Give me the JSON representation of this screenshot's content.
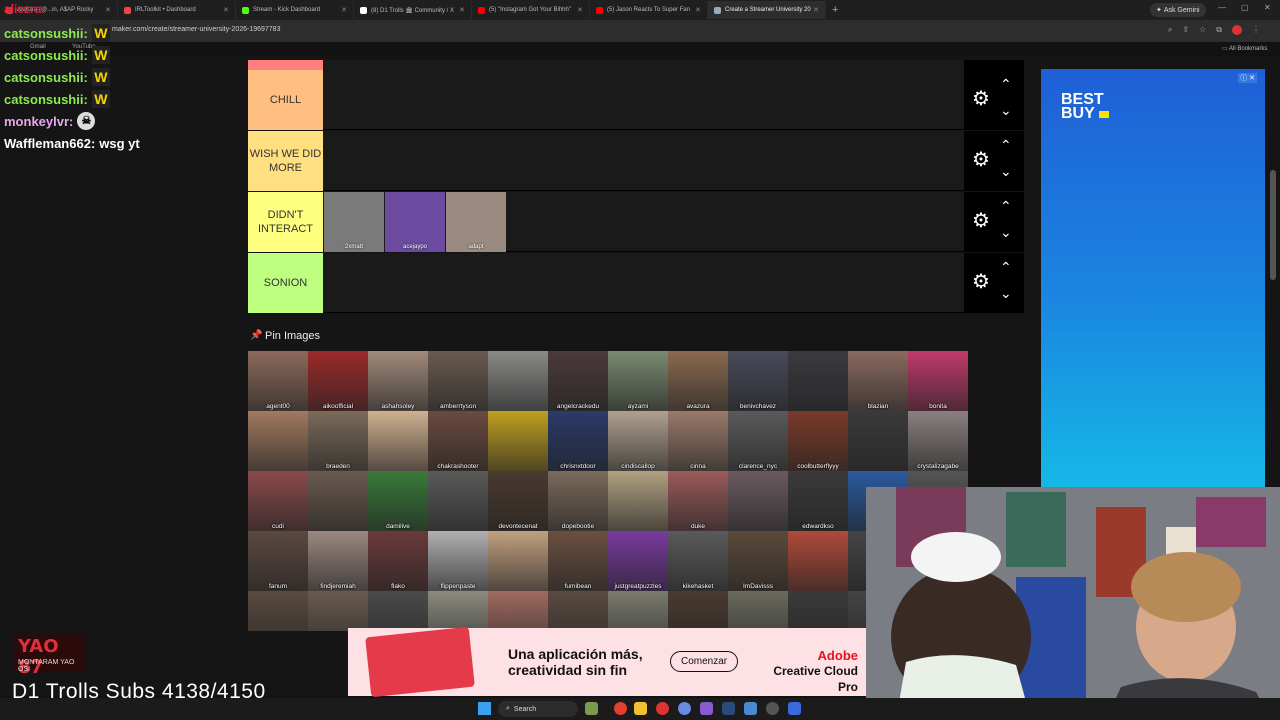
{
  "browser": {
    "tabs": [
      {
        "label": "Aleezra (@...in, A$AP Rocky",
        "color": "#e33"
      },
      {
        "label": "IRLToolkit • Dashboard",
        "color": "#e44"
      },
      {
        "label": "Stream - Kick Dashboard",
        "color": "#53fc18"
      },
      {
        "label": "(8) D1 Trolls 🏛 Community / X",
        "color": "#fff"
      },
      {
        "label": "(5) \"Instagram Got Your Bihhh\"",
        "color": "#f00"
      },
      {
        "label": "(5) Jason Reacts To Super Fan",
        "color": "#f00"
      },
      {
        "label": "Create a Streamer University 20",
        "color": "#9ab"
      }
    ],
    "url": "maker.com/create/streamer-university-2026-19697783",
    "bookmarks": [
      "Gmail",
      "YouTube"
    ],
    "ask_gemini": "Ask Gemini",
    "all_bookmarks": "All Bookmarks"
  },
  "tiers": [
    {
      "label": "CHILL",
      "color": "#ffbf80",
      "items": []
    },
    {
      "label": "WISH WE DID MORE",
      "color": "#ffdf80",
      "items": []
    },
    {
      "label": "DIDN'T INTERACT",
      "color": "#ffff7f",
      "items": [
        {
          "name": "2xmatt",
          "color": "#7a7a7a"
        },
        {
          "name": "acejaypo",
          "color": "#6b4aa0"
        },
        {
          "name": "adapt",
          "color": "#9a8a80"
        }
      ]
    },
    {
      "label": "SONION",
      "color": "#bfff7f",
      "items": []
    }
  ],
  "pin_images_title": "Pin Images",
  "pin_images": [
    {
      "name": "agent00",
      "color": "#8b6a5a"
    },
    {
      "name": "aikoofficial",
      "color": "#9c2a2a"
    },
    {
      "name": "ashahsoley",
      "color": "#a08a7a"
    },
    {
      "name": "amberrtyson",
      "color": "#6a5a50"
    },
    {
      "name": "",
      "color": "#8a8a88"
    },
    {
      "name": "angelcrackedu",
      "color": "#4a3a3a"
    },
    {
      "name": "ayzami",
      "color": "#7a8a70"
    },
    {
      "name": "avazura",
      "color": "#8a6a50"
    },
    {
      "name": "benivchavez",
      "color": "#4a4a5a"
    },
    {
      "name": "",
      "color": "#3a3a40"
    },
    {
      "name": "blazian",
      "color": "#8a6a60"
    },
    {
      "name": "bonita",
      "color": "#c03a6a"
    },
    {
      "name": "",
      "color": "#a07a60"
    },
    {
      "name": "braeden",
      "color": "#7a6a5a"
    },
    {
      "name": "",
      "color": "#d0b090"
    },
    {
      "name": "chakrashooter",
      "color": "#6a4a40"
    },
    {
      "name": "",
      "color": "#c0a020"
    },
    {
      "name": "chrisnxtdoor",
      "color": "#2a3a6a"
    },
    {
      "name": "cindiscallop",
      "color": "#b0a090"
    },
    {
      "name": "cinna",
      "color": "#9a7a6a"
    },
    {
      "name": "clarence_nyc",
      "color": "#5a5a5a"
    },
    {
      "name": "coolbutterflyyy",
      "color": "#7a3a2a"
    },
    {
      "name": "",
      "color": "#3a3a3a"
    },
    {
      "name": "crystalizagabe",
      "color": "#8a8080"
    },
    {
      "name": "cudi",
      "color": "#8a4a4a"
    },
    {
      "name": "",
      "color": "#6a5a50"
    },
    {
      "name": "damilive",
      "color": "#3a7a3a"
    },
    {
      "name": "",
      "color": "#5a5a5a"
    },
    {
      "name": "devontecenat",
      "color": "#4a3a30"
    },
    {
      "name": "dopebootie",
      "color": "#7a6a5a"
    },
    {
      "name": "",
      "color": "#b0a080"
    },
    {
      "name": "duke",
      "color": "#9a5a5a"
    },
    {
      "name": "",
      "color": "#6a5a60"
    },
    {
      "name": "edwardkso",
      "color": "#3a3a3a"
    },
    {
      "name": "",
      "color": "#2a5aa0"
    },
    {
      "name": "",
      "color": "#555"
    },
    {
      "name": "fanum",
      "color": "#5a4a40"
    },
    {
      "name": "findjeremiah",
      "color": "#9a8a80"
    },
    {
      "name": "flako",
      "color": "#6a3a3a"
    },
    {
      "name": "flippenpaste",
      "color": "#b0b0b0"
    },
    {
      "name": "",
      "color": "#c0a080"
    },
    {
      "name": "fumibean",
      "color": "#6a5040"
    },
    {
      "name": "justgreatpuzzles",
      "color": "#7a3aa0"
    },
    {
      "name": "kikehasket",
      "color": "#5a5a5a"
    },
    {
      "name": "ImDavisss",
      "color": "#5a4a3a"
    },
    {
      "name": "",
      "color": "#b04a3a"
    },
    {
      "name": "",
      "color": "#444"
    },
    {
      "name": "",
      "color": "#444"
    },
    {
      "name": "",
      "color": "#5a4a40"
    },
    {
      "name": "",
      "color": "#6a5a50"
    },
    {
      "name": "",
      "color": "#4a4a4a"
    },
    {
      "name": "",
      "color": "#8a8a80"
    },
    {
      "name": "",
      "color": "#a06a60"
    },
    {
      "name": "",
      "color": "#5a4a40"
    },
    {
      "name": "",
      "color": "#7a7a70"
    },
    {
      "name": "",
      "color": "#4a3a30"
    },
    {
      "name": "",
      "color": "#6a6a60"
    },
    {
      "name": "",
      "color": "#3a3a3a"
    },
    {
      "name": "",
      "color": "#444"
    },
    {
      "name": "",
      "color": "#444"
    }
  ],
  "ad": {
    "brand_line1": "BEST",
    "brand_line2": "BUY"
  },
  "chat": [
    {
      "user": "catsonsushii:",
      "msg": "",
      "emote": "W",
      "style": "green"
    },
    {
      "user": "catsonsushii:",
      "msg": "",
      "emote": "W",
      "style": "green"
    },
    {
      "user": "catsonsushii:",
      "msg": "",
      "emote": "W",
      "style": "green"
    },
    {
      "user": "catsonsushii:",
      "msg": "",
      "emote": "W",
      "style": "green"
    },
    {
      "user": "monkeylvr:",
      "msg": "",
      "emote": "☠",
      "style": "pink"
    },
    {
      "user": "Waffleman662:",
      "msg": "wsg yt",
      "emote": "",
      "style": "white"
    }
  ],
  "overlay": {
    "logo_text": "YAO 87",
    "logo_sub": "MONTARAM YAO OSI",
    "subs_label": "D1 Trolls Subs 4138/4150"
  },
  "adobe": {
    "headline1": "Una aplicación más,",
    "headline2": "creatividad sin fin",
    "cta": "Comenzar",
    "brand1": "Adobe",
    "brand2": "Creative Cloud Pro"
  },
  "taskbar": {
    "search": "Search"
  }
}
